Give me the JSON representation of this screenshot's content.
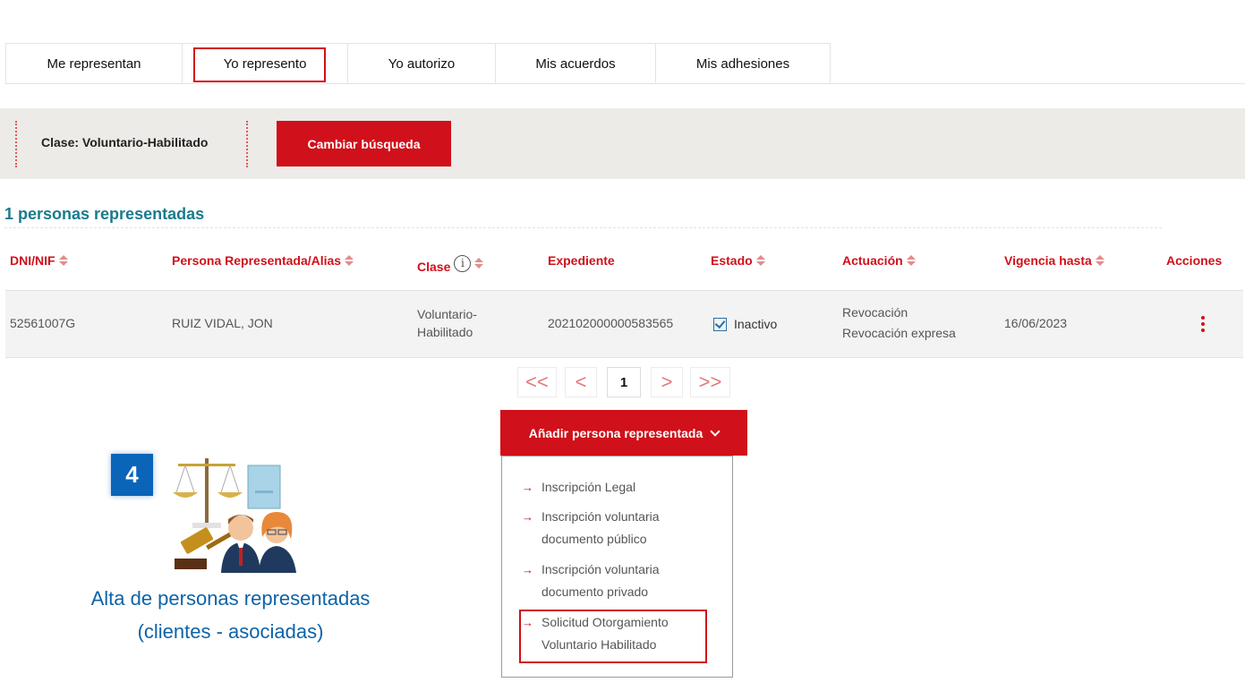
{
  "tabs": [
    {
      "label": "Me representan"
    },
    {
      "label": "Yo represento"
    },
    {
      "label": "Yo autorizo"
    },
    {
      "label": "Mis acuerdos"
    },
    {
      "label": "Mis adhesiones"
    }
  ],
  "filter": {
    "clase_label": "Clase: Voluntario-Habilitado",
    "change_button": "Cambiar búsqueda"
  },
  "results": {
    "count_label": "1 personas representadas"
  },
  "table": {
    "headers": {
      "dni": "DNI/NIF",
      "persona": "Persona Representada/Alias",
      "clase": "Clase",
      "expediente": "Expediente",
      "estado": "Estado",
      "actuacion": "Actuación",
      "vigencia": "Vigencia hasta",
      "acciones": "Acciones"
    },
    "rows": [
      {
        "dni": "52561007G",
        "persona": "RUIZ VIDAL, JON",
        "clase_line1": "Voluntario-",
        "clase_line2": "Habilitado",
        "expediente": "202102000000583565",
        "estado": "Inactivo",
        "actuacion_line1": "Revocación",
        "actuacion_line2": "Revocación expresa",
        "vigencia": "16/06/2023"
      }
    ]
  },
  "pagination": {
    "first": "<<",
    "prev": "<",
    "current": "1",
    "next": ">",
    "last": ">>"
  },
  "add_menu": {
    "button_label": "Añadir persona representada",
    "items": [
      {
        "arrow": "→",
        "line1": "Inscripción Legal",
        "line2": ""
      },
      {
        "arrow": "→",
        "line1": "Inscripción voluntaria",
        "line2": "documento público"
      },
      {
        "arrow": "→",
        "line1": "Inscripción voluntaria",
        "line2": "documento privado"
      },
      {
        "arrow": "→",
        "line1": "Solicitud Otorgamiento",
        "line2": "Voluntario Habilitado"
      }
    ]
  },
  "annotation": {
    "step_number": "4",
    "caption_line1": "Alta de personas representadas",
    "caption_line2": "(clientes - asociadas)"
  },
  "colors": {
    "primary_red": "#d0101a",
    "teal": "#1a7b8c",
    "badge_blue": "#0a64b8",
    "caption_blue": "#0d63a8",
    "filter_bg": "#ecebe8"
  },
  "icons": [
    "info-icon",
    "sort-icon",
    "checkbox-icon",
    "kebab-menu-icon",
    "chevron-down-icon",
    "arrow-right-icon"
  ]
}
